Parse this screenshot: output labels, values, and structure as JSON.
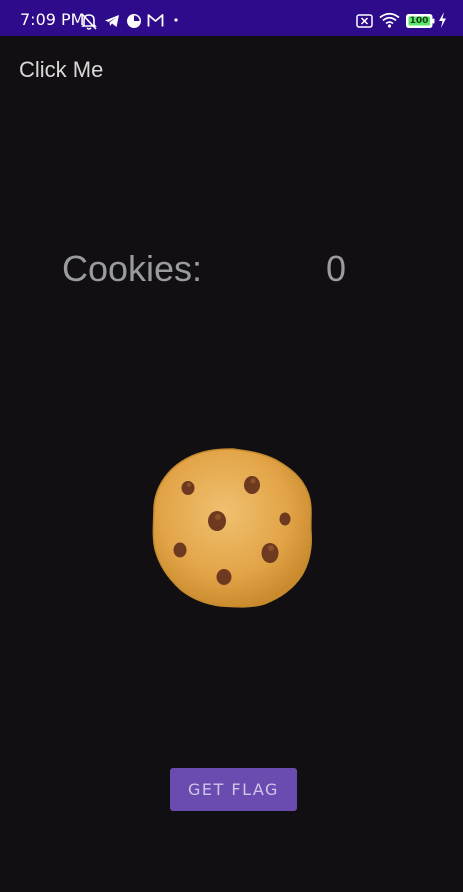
{
  "status_bar": {
    "time": "7:09 PM",
    "battery_level": "100",
    "left_icons": [
      "bell-off-icon",
      "telegram-icon",
      "screen-record-icon",
      "gmail-icon",
      "dot-icon"
    ],
    "right_icons": [
      "sim-off-icon",
      "wifi-icon",
      "battery-icon",
      "charging-bolt-icon"
    ]
  },
  "app_bar": {
    "title": "Click Me"
  },
  "counter": {
    "label": "Cookies:",
    "value": "0"
  },
  "cookie": {
    "icon": "cookie-icon"
  },
  "actions": {
    "get_flag_label": "GET FLAG"
  },
  "colors": {
    "status_bar": "#2d0b8a",
    "background": "#120f12",
    "button": "#6a4bb0",
    "text_muted": "#9a9a9f"
  }
}
